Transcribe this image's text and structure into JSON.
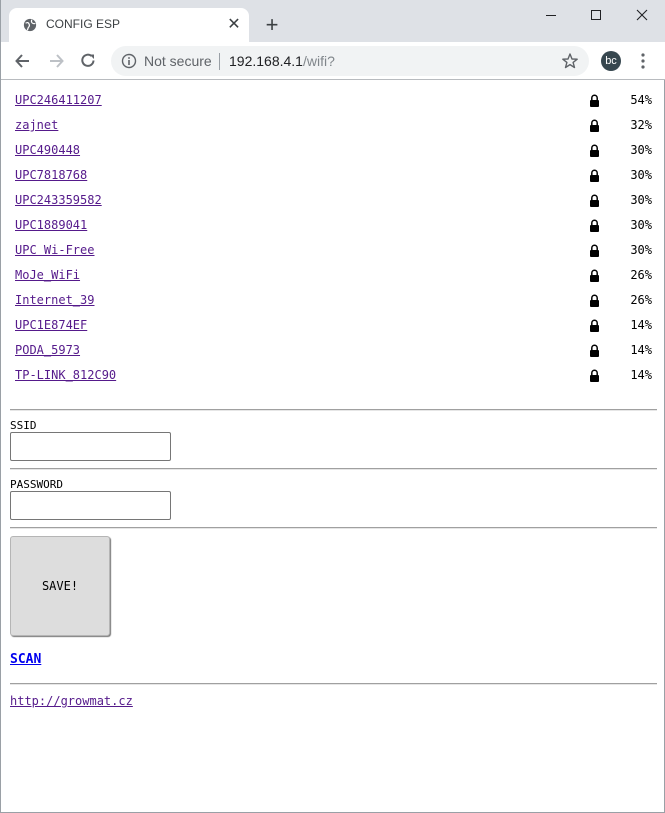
{
  "browser": {
    "tab_title": "CONFIG ESP",
    "close_tab": "✕",
    "new_tab": "+",
    "security_label": "Not secure",
    "url_host": "192.168.4.1",
    "url_path": "/wifi?",
    "profile_initials": "bc"
  },
  "networks": [
    {
      "ssid": "UPC246411207",
      "signal": "54%"
    },
    {
      "ssid": "zajnet",
      "signal": "32%"
    },
    {
      "ssid": "UPC490448",
      "signal": "30%"
    },
    {
      "ssid": "UPC7818768",
      "signal": "30%"
    },
    {
      "ssid": "UPC243359582",
      "signal": "30%"
    },
    {
      "ssid": "UPC1889041",
      "signal": "30%"
    },
    {
      "ssid": "UPC Wi-Free",
      "signal": "30%"
    },
    {
      "ssid": "MoJe_WiFi",
      "signal": "26%"
    },
    {
      "ssid": "Internet_39",
      "signal": "26%"
    },
    {
      "ssid": "UPC1E874EF",
      "signal": "14%"
    },
    {
      "ssid": "PODA_5973",
      "signal": "14%"
    },
    {
      "ssid": "TP-LINK_812C90",
      "signal": "14%"
    }
  ],
  "form": {
    "ssid_label": "SSID",
    "ssid_value": "",
    "password_label": "PASSWORD",
    "password_value": "",
    "save_label": "SAVE!"
  },
  "scan_label": "SCAN",
  "footer_link": "http://growmat.cz",
  "colors": {
    "tabstrip": "#dee1e6",
    "visited_link": "#551a8b",
    "link": "#0000ee",
    "button_bg": "#dddddd"
  }
}
